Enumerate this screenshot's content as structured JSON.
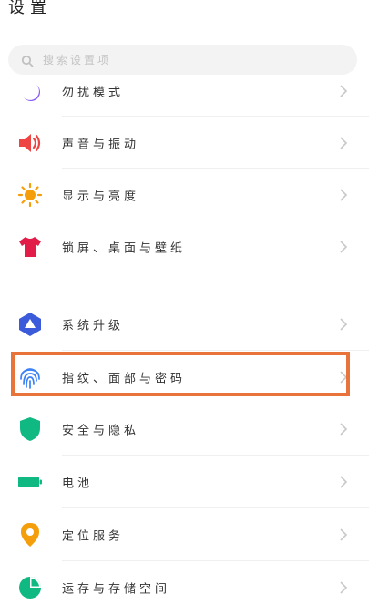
{
  "header": {
    "title": "设置"
  },
  "search": {
    "placeholder": "搜索设置项"
  },
  "items": [
    {
      "label": "勿扰模式",
      "icon": "moon-icon",
      "color": "#8b5cf6"
    },
    {
      "label": "声音与振动",
      "icon": "speaker-icon",
      "color": "#ef4444"
    },
    {
      "label": "显示与亮度",
      "icon": "sun-icon",
      "color": "#f59e0b"
    },
    {
      "label": "锁屏、桌面与壁纸",
      "icon": "shirt-icon",
      "color": "#e11d48"
    },
    {
      "label": "系统升级",
      "icon": "system-update-icon",
      "color": "#3b5bdb"
    },
    {
      "label": "指纹、面部与密码",
      "icon": "fingerprint-icon",
      "color": "#3b82f6"
    },
    {
      "label": "安全与隐私",
      "icon": "shield-icon",
      "color": "#10b981"
    },
    {
      "label": "电池",
      "icon": "battery-icon",
      "color": "#10b981"
    },
    {
      "label": "定位服务",
      "icon": "location-pin-icon",
      "color": "#f59e0b"
    },
    {
      "label": "运存与存储空间",
      "icon": "storage-pie-icon",
      "color": "#10b981"
    }
  ],
  "highlight": {
    "color": "#e8733b",
    "target": "指纹、面部与密码"
  }
}
